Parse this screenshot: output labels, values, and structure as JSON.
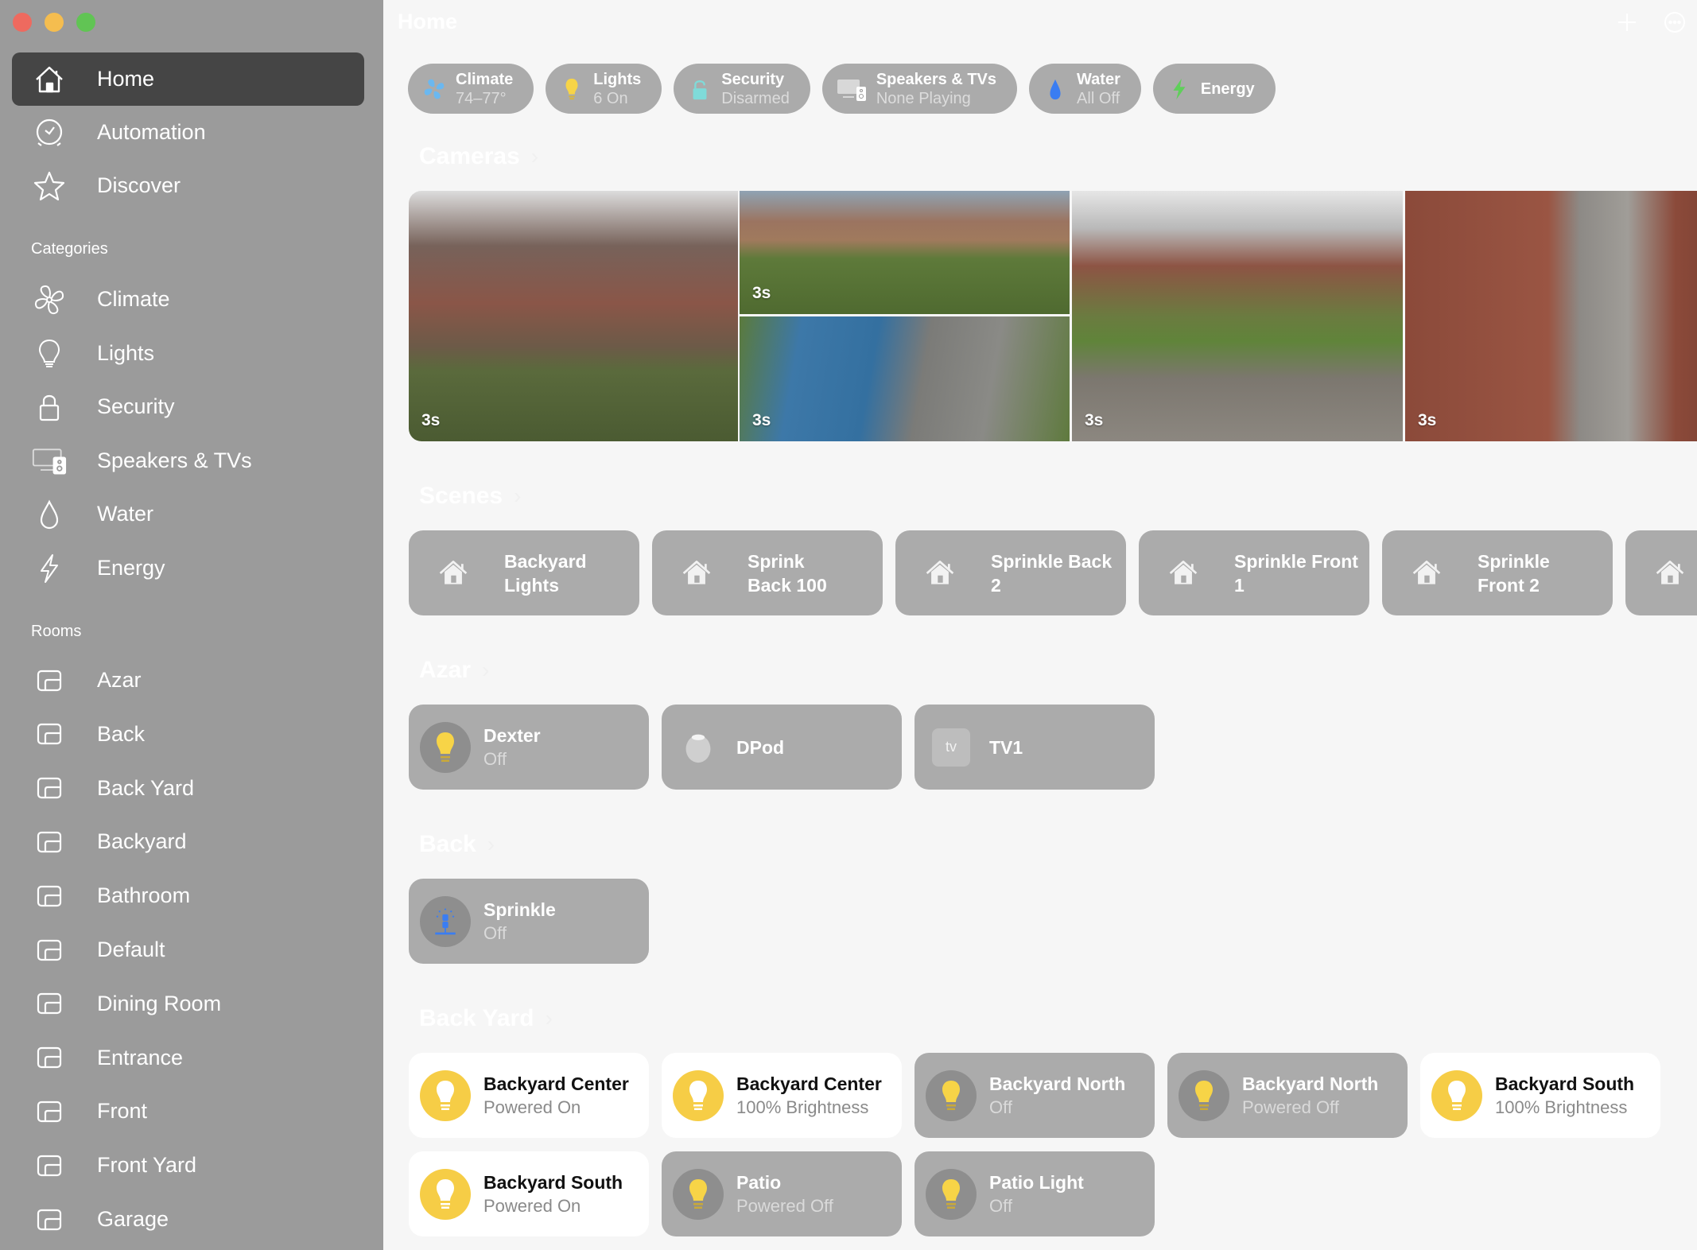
{
  "window": {
    "traffic_lights": [
      "close",
      "minimize",
      "zoom"
    ]
  },
  "sidebar": {
    "main_items": [
      {
        "label": "Home",
        "icon": "house-icon",
        "active": true
      },
      {
        "label": "Automation",
        "icon": "clock-icon",
        "active": false
      },
      {
        "label": "Discover",
        "icon": "star-icon",
        "active": false
      }
    ],
    "categories_label": "Categories",
    "categories": [
      {
        "label": "Climate",
        "icon": "fan-icon"
      },
      {
        "label": "Lights",
        "icon": "lightbulb-icon"
      },
      {
        "label": "Security",
        "icon": "lock-icon"
      },
      {
        "label": "Speakers & TVs",
        "icon": "tv-speaker-icon"
      },
      {
        "label": "Water",
        "icon": "drop-icon"
      },
      {
        "label": "Energy",
        "icon": "bolt-icon"
      }
    ],
    "rooms_label": "Rooms",
    "rooms": [
      "Azar",
      "Back",
      "Back Yard",
      "Backyard",
      "Bathroom",
      "Default",
      "Dining Room",
      "Entrance",
      "Front",
      "Front Yard",
      "Garage"
    ]
  },
  "header": {
    "title": "Home",
    "add_icon": "plus-icon",
    "more_icon": "ellipsis-circle-icon"
  },
  "status_pills": [
    {
      "title": "Climate",
      "subtitle": "74–77°",
      "icon": "fan-icon",
      "color": "#6bb8f0"
    },
    {
      "title": "Lights",
      "subtitle": "6 On",
      "icon": "lightbulb-icon",
      "color": "#f7d447"
    },
    {
      "title": "Security",
      "subtitle": "Disarmed",
      "icon": "lock-icon",
      "color": "#7fdbd9"
    },
    {
      "title": "Speakers & TVs",
      "subtitle": "None Playing",
      "icon": "tv-speaker-icon",
      "color": "#d8d8d8"
    },
    {
      "title": "Water",
      "subtitle": "All Off",
      "icon": "drop-icon",
      "color": "#3a7df2"
    },
    {
      "title": "Energy",
      "subtitle": "",
      "icon": "bolt-icon",
      "color": "#5fcf5a"
    }
  ],
  "cameras": {
    "heading": "Cameras",
    "chevron": "›",
    "feeds": [
      {
        "label": "3s",
        "scene": "front porch brick house"
      },
      {
        "label": "3s",
        "scene": "yard with birdbath"
      },
      {
        "label": "3s",
        "scene": "driveway with blue car"
      },
      {
        "label": "3s",
        "scene": "covered patio backyard"
      },
      {
        "label": "3s",
        "scene": "brick walkway"
      }
    ]
  },
  "scenes": {
    "heading": "Scenes",
    "chevron": "›",
    "items": [
      {
        "line1": "Backyard",
        "line2": "Lights"
      },
      {
        "line1": "Sprink",
        "line2": "Back 100"
      },
      {
        "line1": "Sprinkle Back 2",
        "line2": ""
      },
      {
        "line1": "Sprinkle Front 1",
        "line2": ""
      },
      {
        "line1": "Sprinkle",
        "line2": "Front 2"
      },
      {
        "line1": "",
        "line2": ""
      }
    ]
  },
  "rooms_sections": [
    {
      "heading": "Azar",
      "chevron": "›",
      "accessories": [
        {
          "name": "Dexter",
          "status": "Off",
          "icon": "lightbulb-icon",
          "on": false
        },
        {
          "name": "DPod",
          "status": "",
          "icon": "homepod-icon",
          "on": false
        },
        {
          "name": "TV1",
          "status": "",
          "icon": "appletv-icon",
          "on": false,
          "badge": "tv"
        }
      ]
    },
    {
      "heading": "Back",
      "chevron": "›",
      "accessories": [
        {
          "name": "Sprinkle",
          "status": "Off",
          "icon": "sprinkler-icon",
          "on": false
        }
      ]
    },
    {
      "heading": "Back Yard",
      "chevron": "›",
      "accessories": [
        {
          "name": "Backyard Center",
          "status": "Powered On",
          "icon": "lightbulb-icon",
          "on": true
        },
        {
          "name": "Backyard Center",
          "status": "100% Brightness",
          "icon": "lightbulb-icon",
          "on": true
        },
        {
          "name": "Backyard North",
          "status": "Off",
          "icon": "lightbulb-icon",
          "on": false
        },
        {
          "name": "Backyard North",
          "status": "Powered Off",
          "icon": "lightbulb-icon",
          "on": false
        },
        {
          "name": "Backyard South",
          "status": "100% Brightness",
          "icon": "lightbulb-icon",
          "on": true
        },
        {
          "name": "Backyard South",
          "status": "Powered On",
          "icon": "lightbulb-icon",
          "on": true
        },
        {
          "name": "Patio",
          "status": "Powered Off",
          "icon": "lightbulb-icon",
          "on": false
        },
        {
          "name": "Patio Light",
          "status": "Off",
          "icon": "lightbulb-icon",
          "on": false
        }
      ]
    }
  ],
  "colors": {
    "sidebar_bg": "#9b9b9b",
    "sidebar_active": "#454545",
    "tile_off": "#ababab",
    "tile_on": "#ffffff",
    "bulb_yellow": "#f6cd46",
    "content_bg": "#f6f6f6"
  }
}
